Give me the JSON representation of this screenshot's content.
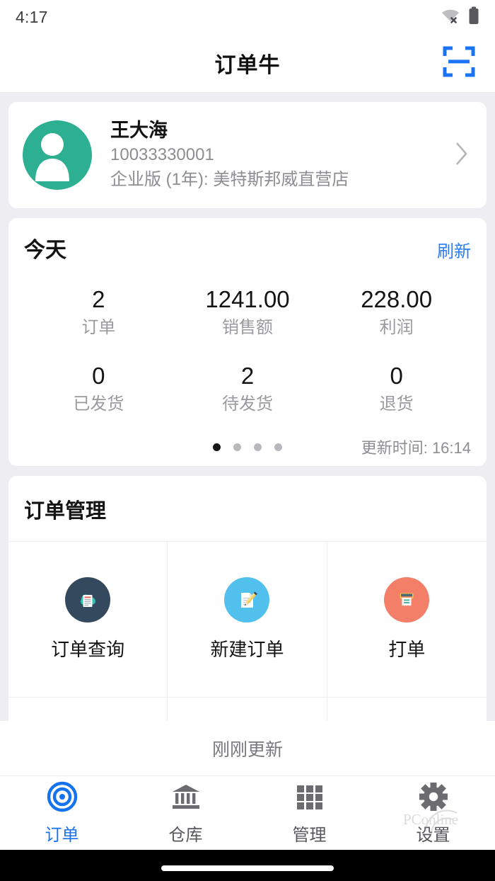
{
  "status_bar": {
    "time": "4:17",
    "wifi_icon": "wifi-off-icon",
    "battery_icon": "battery-full-icon"
  },
  "header": {
    "title": "订单牛",
    "scan_icon": "scan-qr-icon",
    "scan_color": "#1a73f5"
  },
  "profile": {
    "avatar_icon": "user-avatar-icon",
    "avatar_color": "#2db092",
    "name": "王大海",
    "account_id": "10033330001",
    "plan": "企业版 (1年): 美特斯邦威直营店",
    "chevron_icon": "chevron-right-icon"
  },
  "stats": {
    "title": "今天",
    "refresh_label": "刷新",
    "refresh_color": "#2a7cf5",
    "row1": [
      {
        "value": "2",
        "label": "订单"
      },
      {
        "value": "1241.00",
        "label": "销售额"
      },
      {
        "value": "228.00",
        "label": "利润"
      }
    ],
    "row2": [
      {
        "value": "0",
        "label": "已发货"
      },
      {
        "value": "2",
        "label": "待发货"
      },
      {
        "value": "0",
        "label": "退货"
      }
    ],
    "pagination": {
      "count": 4,
      "active_index": 0
    },
    "update_time": "更新时间: 16:14"
  },
  "order_management": {
    "title": "订单管理",
    "items": [
      {
        "label": "订单查询",
        "icon": "cloud-document-icon",
        "bg": "#34495e",
        "accent": "#35c2b5"
      },
      {
        "label": "新建订单",
        "icon": "document-pencil-icon",
        "bg": "#52c0ec",
        "accent": "#f2c14a"
      },
      {
        "label": "打单",
        "icon": "printer-receipt-icon",
        "bg": "#f37f68",
        "accent": "#f2c14a"
      }
    ]
  },
  "pull_refresh": {
    "text": "刚刚更新"
  },
  "tabbar": {
    "items": [
      {
        "label": "订单",
        "icon": "target-icon",
        "active": true
      },
      {
        "label": "仓库",
        "icon": "bank-warehouse-icon",
        "active": false
      },
      {
        "label": "管理",
        "icon": "grid-apps-icon",
        "active": false
      },
      {
        "label": "设置",
        "icon": "gear-settings-icon",
        "active": false
      }
    ],
    "active_color": "#1673f0",
    "inactive_color": "#57575c"
  },
  "watermark": {
    "text": "PConline"
  }
}
